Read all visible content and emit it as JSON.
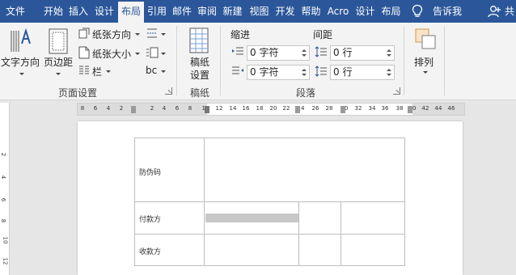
{
  "tabs": [
    {
      "label": "文件",
      "active": false
    },
    {
      "label": "开始",
      "active": false
    },
    {
      "label": "插入",
      "active": false
    },
    {
      "label": "设计",
      "active": false
    },
    {
      "label": "布局",
      "active": true
    },
    {
      "label": "引用",
      "active": false
    },
    {
      "label": "邮件",
      "active": false
    },
    {
      "label": "审阅",
      "active": false
    },
    {
      "label": "新建",
      "active": false
    },
    {
      "label": "视图",
      "active": false
    },
    {
      "label": "开发",
      "active": false
    },
    {
      "label": "帮助",
      "active": false
    },
    {
      "label": "Acro",
      "active": false
    },
    {
      "label": "设计",
      "active": false
    },
    {
      "label": "布局",
      "active": false
    }
  ],
  "tell_me": "告诉我",
  "share": "共",
  "ribbon": {
    "page_setup": {
      "text_direction": "文字方向",
      "margins": "页边距",
      "orientation": "纸张方向",
      "size": "纸张大小",
      "columns": "栏",
      "bc": "bc",
      "group_label": "页面设置"
    },
    "manuscript": {
      "button_line1": "稿纸",
      "button_line2": "设置",
      "group_label": "稿纸"
    },
    "paragraph": {
      "indent_title": "缩进",
      "spacing_title": "间距",
      "indent_left": "0 字符",
      "indent_right": "0 字符",
      "spacing_before": "0 行",
      "spacing_after": "0 行",
      "group_label": "段落"
    },
    "arrange": {
      "label": "排列"
    }
  },
  "ruler": {
    "labels": [
      "8",
      "6",
      "4",
      "2",
      "2",
      "4",
      "6",
      "8",
      "10",
      "12",
      "14",
      "16",
      "18",
      "20",
      "22",
      "24",
      "26",
      "28",
      "30",
      "32",
      "34",
      "36",
      "38",
      "40",
      "42",
      "44",
      "46"
    ],
    "vertical_labels": [
      "2",
      "4",
      "6",
      "8",
      "10",
      "12"
    ]
  },
  "table": {
    "row1_label": "防伪码",
    "row2_label": "付款方",
    "row3_label": "收款方"
  },
  "colors": {
    "title_bar": "#2b579a",
    "ribbon_bg": "#f3f3f3",
    "canvas_bg": "#e6e6e6"
  }
}
